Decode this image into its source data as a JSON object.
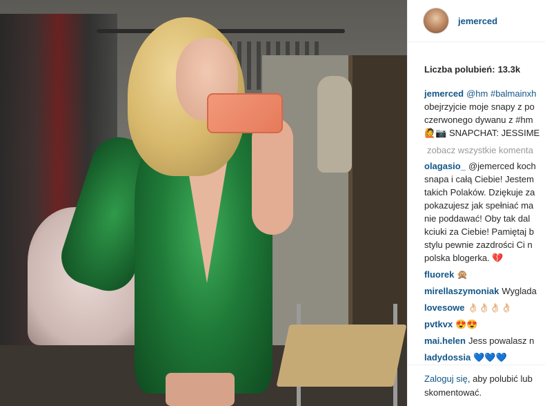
{
  "post": {
    "username": "jemerced",
    "likes_label": "Liczba polubień:",
    "likes_count": "13.3k",
    "caption": {
      "user": "jemerced",
      "lines": [
        "@hm #balmainxh",
        "obejrzyjcie moje snapy z po",
        "czerwonego dywanu z #hm",
        "🙋📷 SNAPCHAT: JESSIME"
      ]
    },
    "view_all": "zobacz wszystkie komenta"
  },
  "comments": [
    {
      "user": "olagasio_",
      "lines": [
        "@jemerced koch",
        "snapa i całą Ciebie! Jestem",
        "takich Polaków. Dziękuje za",
        "pokazujesz jak spełniać ma",
        "nie poddawać! Oby tak dal",
        "kciuki za Ciebie! Pamiętaj b",
        "stylu pewnie zazdrości Ci n",
        "polska blogerka. 💔"
      ]
    },
    {
      "user": "fluorek",
      "text": "🙊"
    },
    {
      "user": "mirellaszymoniak",
      "text": "Wyglada"
    },
    {
      "user": "lovesowe",
      "text": "👌🏻👌🏻👌🏻👌🏻"
    },
    {
      "user": "pvtkvx",
      "text": "😍😍"
    },
    {
      "user": "mai.helen",
      "text": "Jess powalasz n"
    },
    {
      "user": "ladydossia",
      "text": "💙💙💙"
    }
  ],
  "footer": {
    "login_link": "Zaloguj się",
    "text_1": ", aby polubić lub",
    "text_2": "skomentować."
  },
  "icons": {
    "avatar": "profile-avatar",
    "photo": "selfie-photo"
  },
  "colors": {
    "link": "#125688",
    "muted": "#999999",
    "text": "#262626"
  }
}
